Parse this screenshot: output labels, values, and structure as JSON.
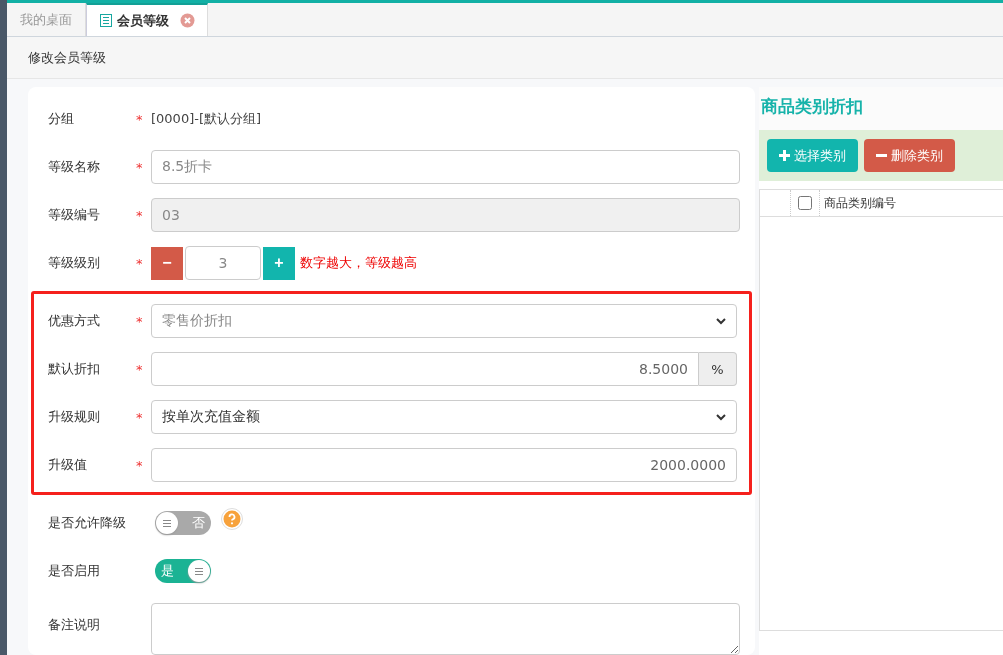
{
  "tabs": [
    {
      "label": "我的桌面",
      "selected": false
    },
    {
      "label": "会员等级",
      "selected": true
    }
  ],
  "page_title": "修改会员等级",
  "form": {
    "required_mark": "*",
    "rows": [
      {
        "kind": "static",
        "label": "分组",
        "required": true,
        "value": "[0000]-[默认分组]",
        "highlighted": false
      },
      {
        "kind": "text",
        "label": "等级名称",
        "required": true,
        "value": "8.5折卡",
        "disabled": false,
        "highlighted": false
      },
      {
        "kind": "text",
        "label": "等级编号",
        "required": true,
        "value": "03",
        "disabled": true,
        "highlighted": false
      },
      {
        "kind": "stepper",
        "label": "等级级别",
        "required": true,
        "value": "3",
        "minus": "−",
        "plus": "+",
        "hint": "数字越大，等级越高",
        "highlighted": false
      },
      {
        "kind": "select",
        "label": "优惠方式",
        "required": true,
        "value": "零售价折扣",
        "muted": true,
        "highlighted": true
      },
      {
        "kind": "addon",
        "label": "默认折扣",
        "required": true,
        "value": "8.5000",
        "addon": "%",
        "highlighted": true
      },
      {
        "kind": "select",
        "label": "升级规则",
        "required": true,
        "value": "按单次充值金额",
        "muted": false,
        "highlighted": true
      },
      {
        "kind": "number",
        "label": "升级值",
        "required": true,
        "value": "2000.0000",
        "highlighted": true
      },
      {
        "kind": "toggle",
        "label": "是否允许降级",
        "required": false,
        "on": false,
        "text": "否",
        "help": true,
        "highlighted": false
      },
      {
        "kind": "toggle",
        "label": "是否启用",
        "required": false,
        "on": true,
        "text": "是",
        "highlighted": false
      },
      {
        "kind": "textarea",
        "label": "备注说明",
        "required": false,
        "highlighted": false
      }
    ]
  },
  "category_panel": {
    "title": "商品类别折扣",
    "buttons": [
      {
        "label": "选择类别",
        "kind": "add"
      },
      {
        "label": "删除类别",
        "kind": "remove"
      }
    ],
    "table": {
      "columns": [
        "商品类别编号"
      ],
      "select_all_checked": false
    }
  }
}
